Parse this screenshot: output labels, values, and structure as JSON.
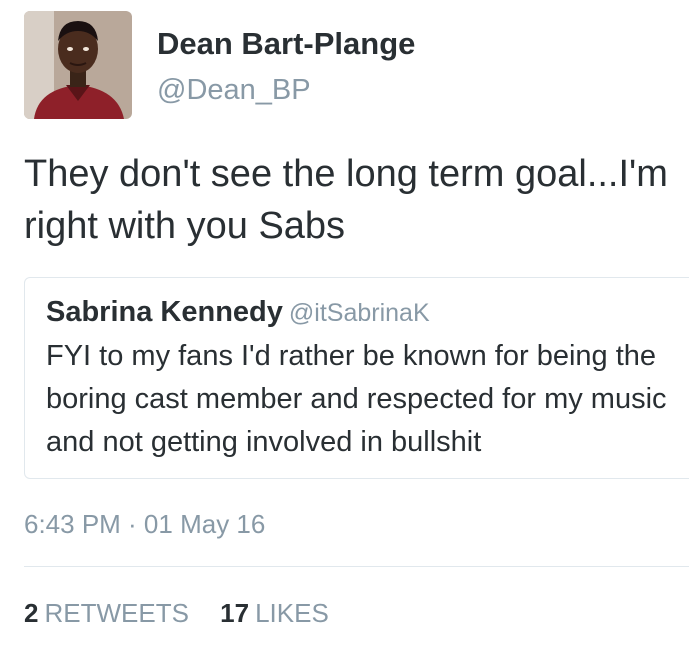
{
  "author": {
    "display_name": "Dean Bart-Plange",
    "handle": "@Dean_BP",
    "avatar_icon": "user-avatar-photo"
  },
  "tweet": {
    "text": "They don't see the long term goal...I'm right with you Sabs"
  },
  "quoted_tweet": {
    "display_name": "Sabrina Kennedy",
    "handle": "@itSabrinaK",
    "text": "FYI to my fans I'd rather be known for being the boring cast member and respected for my music and not getting involved in bullshit"
  },
  "meta": {
    "timestamp": "6:43 PM · 01 May 16"
  },
  "stats": {
    "retweets_count": "2",
    "retweets_label": "RETWEETS",
    "likes_count": "17",
    "likes_label": "LIKES"
  },
  "colors": {
    "text": "#292f33",
    "secondary": "#8899a6",
    "border": "#e1e8ed"
  }
}
